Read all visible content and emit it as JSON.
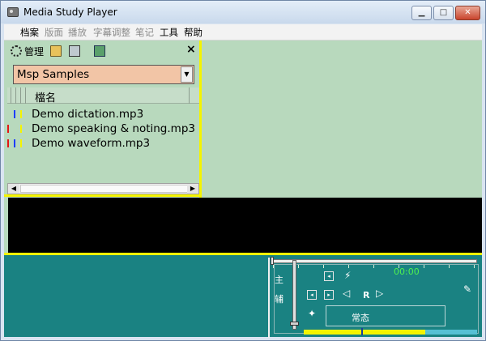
{
  "window": {
    "title": "Media Study Player",
    "controls": {
      "minimize": "▁",
      "maximize": "□",
      "close": "✕"
    }
  },
  "menubar": {
    "items": [
      {
        "label": "档案",
        "enabled": true
      },
      {
        "label": "版面",
        "enabled": false
      },
      {
        "label": "播放",
        "enabled": false
      },
      {
        "label": "字幕调整",
        "enabled": false
      },
      {
        "label": "笔记",
        "enabled": false
      },
      {
        "label": "工具",
        "enabled": true
      },
      {
        "label": "帮助",
        "enabled": true
      }
    ]
  },
  "left_panel": {
    "toolbar": {
      "manage_label": "管理",
      "icons": [
        "gear-icon",
        "folder-open-icon",
        "disk-icon",
        "tree-icon"
      ],
      "close_label": "×"
    },
    "collection": {
      "selected": "Msp Samples"
    },
    "file_list": {
      "column_header": "檔名",
      "rows": [
        {
          "name": "Demo dictation.mp3",
          "marks": [
            "#1e3cff",
            "#f4f400"
          ]
        },
        {
          "name": "Demo speaking & noting.mp3",
          "marks": [
            "#e41616",
            "#f4f400"
          ]
        },
        {
          "name": "Demo waveform.mp3",
          "marks": [
            "#e41616",
            "#1e3cff",
            "#f4f400"
          ]
        }
      ]
    }
  },
  "player": {
    "side_labels": [
      "主",
      "辅"
    ],
    "time": "00:00",
    "repeat_label": "R",
    "mode_label": "常态",
    "level_fraction": 0.7,
    "colors": {
      "panel": "#b8d9bd",
      "controls": "#1a8282",
      "accent": "#f4f400",
      "time": "#4ff24f"
    }
  }
}
